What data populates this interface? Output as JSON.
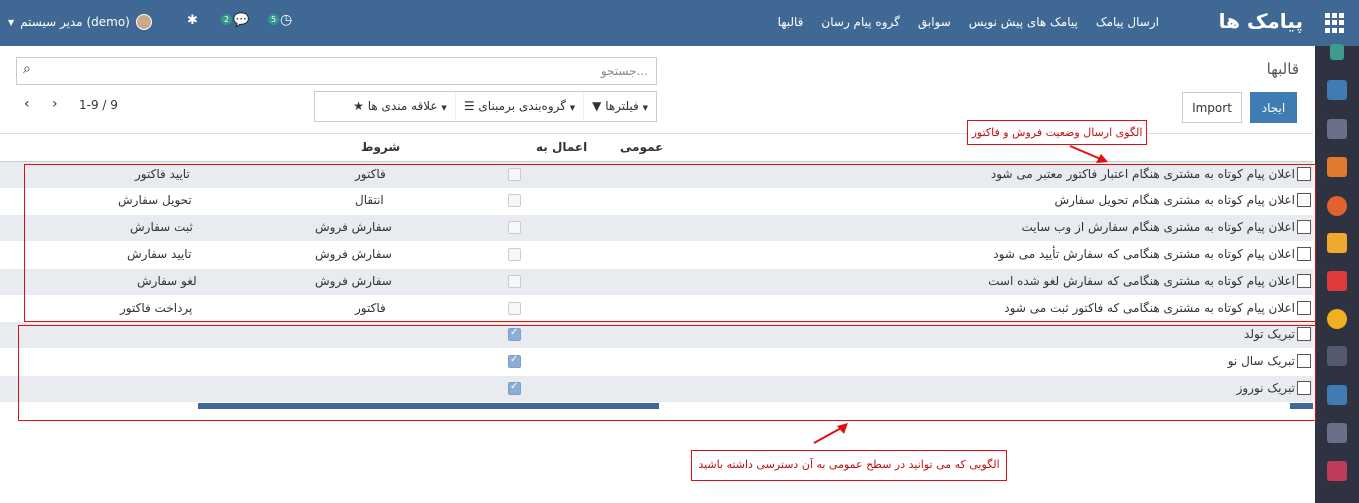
{
  "topbar": {
    "brand": "پیامک ها",
    "menu": [
      "ارسال پیامک",
      "پیامک های پیش نویس",
      "سوابق",
      "گروه پیام رسان",
      "قالبها"
    ],
    "user": "مدیر سیستم (demo)",
    "badge_activity": "5",
    "badge_messages": "2"
  },
  "cp": {
    "breadcrumb": "قالبها",
    "search_placeholder": "جستجو...",
    "create_label": "ایجاد",
    "import_label": "Import",
    "filters_label": "فیلترها",
    "groupby_label": "گروه‌بندی برمبنای",
    "favorites_label": "علاقه مندی ها",
    "pager": "1-9 / 9"
  },
  "table": {
    "headers": {
      "public": "عمومی",
      "apply_to": "اعمال به",
      "conditions": "شروط"
    },
    "rows": [
      {
        "name": "اعلان پیام کوتاه به مشتری هنگام اعتبار فاکتور معتبر می شود",
        "model": "فاکتور",
        "cond": "تایید فاکتور",
        "public": false
      },
      {
        "name": "اعلان پیام کوتاه به مشتری هنگام تحویل سفارش",
        "model": "انتقال",
        "cond": "تحویل سفارش",
        "public": false
      },
      {
        "name": "اعلان پیام کوتاه به مشتری هنگام سفارش از وب سایت",
        "model": "سفارش فروش",
        "cond": "ثبت سفارش",
        "public": false
      },
      {
        "name": "اعلان پیام کوتاه به مشتری هنگامی که سفارش تأیید می شود",
        "model": "سفارش فروش",
        "cond": "تایید سفارش",
        "public": false
      },
      {
        "name": "اعلان پیام کوتاه به مشتری هنگامی که سفارش لغو شده است",
        "model": "سفارش فروش",
        "cond": "لغو سفارش",
        "public": false
      },
      {
        "name": "اعلان پیام کوتاه به مشتری هنگامی که فاکتور ثبت می شود",
        "model": "فاکتور",
        "cond": "پرداخت فاکتور",
        "public": false
      },
      {
        "name": "تبریک تولد",
        "model": "",
        "cond": "",
        "public": true
      },
      {
        "name": "تبریک سال نو",
        "model": "",
        "cond": "",
        "public": true
      },
      {
        "name": "تبریک نوروز",
        "model": "",
        "cond": "",
        "public": true
      }
    ]
  },
  "annotations": {
    "top": "الگوی ارسال وضعیت فروش و فاکتور",
    "bottom": "الگویی که می توانید در سطح عمومی به آن دسترسی داشته باشید"
  },
  "colors": {
    "topbar": "#3f6894",
    "sidebar": "#2f3240",
    "annotation": "#e01010"
  }
}
